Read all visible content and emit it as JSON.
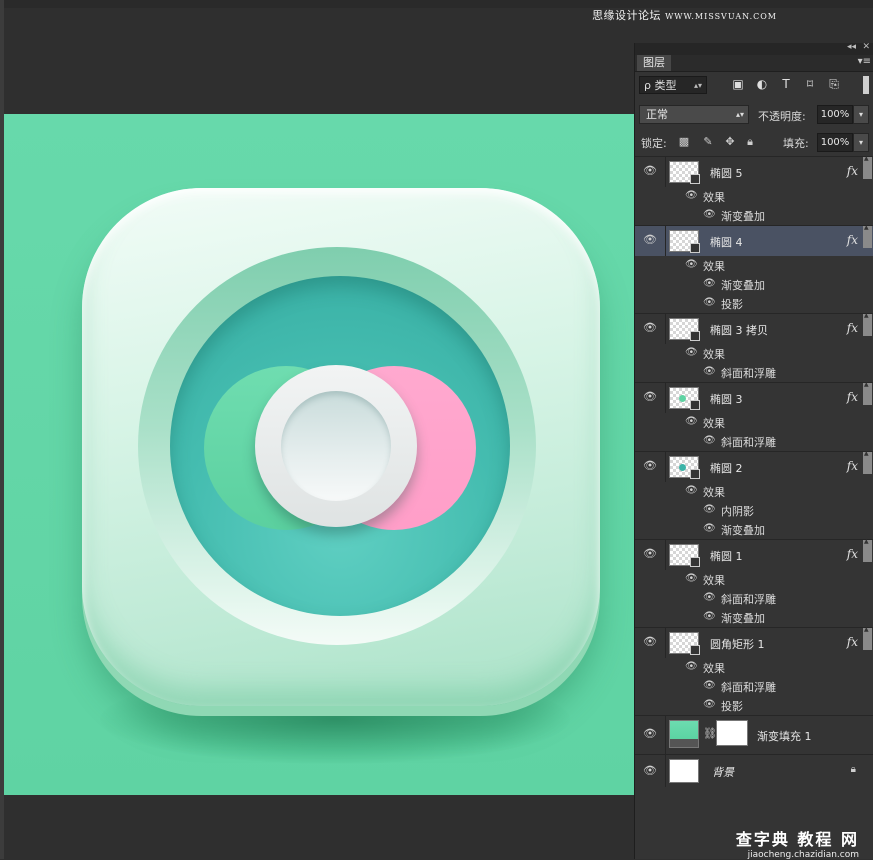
{
  "watermark_top": {
    "cn": "思缘设计论坛",
    "url": "WWW.MISSVUAN.COM"
  },
  "panel": {
    "collapse_glyph": "◂◂",
    "close_glyph": "✕",
    "tab": "图层",
    "menu_glyph": "▾≡",
    "filter_label": "ρ 类型",
    "filter_icons": [
      "image-filter-icon",
      "adjustment-filter-icon",
      "type-filter-icon",
      "shape-filter-icon",
      "smartobject-filter-icon"
    ],
    "blend_mode": "正常",
    "opacity_label": "不透明度:",
    "opacity_value": "100%",
    "lock_label": "锁定:",
    "fill_label": "填充:",
    "fill_value": "100%"
  },
  "layers": [
    {
      "name": "椭圆 5",
      "fx": "fx",
      "effects_label": "效果",
      "effects": [
        "渐变叠加"
      ],
      "dot_color": ""
    },
    {
      "name": "椭圆 4",
      "fx": "fx",
      "effects_label": "效果",
      "effects": [
        "渐变叠加",
        "投影"
      ],
      "selected": true,
      "dot_color": ""
    },
    {
      "name": "椭圆 3 拷贝",
      "fx": "fx",
      "effects_label": "效果",
      "effects": [
        "斜面和浮雕"
      ],
      "dot_color": ""
    },
    {
      "name": "椭圆 3",
      "fx": "fx",
      "effects_label": "效果",
      "effects": [
        "斜面和浮雕"
      ],
      "dot_color": "#5fd3a3"
    },
    {
      "name": "椭圆 2",
      "fx": "fx",
      "effects_label": "效果",
      "effects": [
        "内阴影",
        "渐变叠加"
      ],
      "dot_color": "#3cb4a8"
    },
    {
      "name": "椭圆 1",
      "fx": "fx",
      "effects_label": "效果",
      "effects": [
        "斜面和浮雕",
        "渐变叠加"
      ],
      "dot_color": ""
    },
    {
      "name": "圆角矩形 1",
      "fx": "fx",
      "effects_label": "效果",
      "effects": [
        "斜面和浮雕",
        "投影"
      ],
      "dot_color": ""
    }
  ],
  "gradient_fill_layer": {
    "name": "渐变填充 1"
  },
  "background_layer": {
    "name": "背景"
  },
  "watermark_bottom": {
    "big": "查字典 教程 网",
    "small": "jiaocheng.chazidian.com"
  },
  "colors": {
    "canvas_bg": "#62d6a6",
    "pink_disc": "#ffa3cc",
    "teal_well": "#3fb6aa",
    "selected_layer": "#4a5263"
  }
}
